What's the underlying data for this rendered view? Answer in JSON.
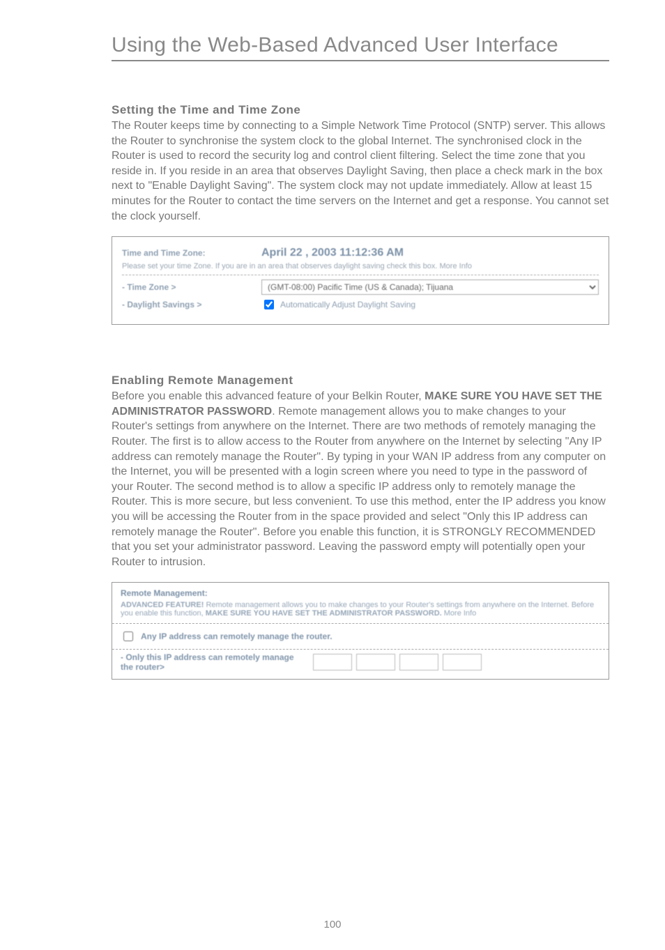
{
  "header": {
    "chapter_title": "Using the Web-Based Advanced User Interface"
  },
  "section1": {
    "title": "Setting the Time and Time Zone",
    "body": "The Router keeps time by connecting to a Simple Network Time Protocol (SNTP) server. This allows the Router to synchronise the system clock to the global Internet. The synchronised clock in the Router is used to record the security log and control client filtering. Select the time zone that you reside in. If you reside in an area that observes Daylight Saving, then place a check mark in the box next to \"Enable Daylight Saving\". The system clock may not update immediately. Allow at least 15 minutes for the Router to contact the time servers on the Internet and get a response. You cannot set the clock yourself."
  },
  "time_panel": {
    "heading": "Time and Time Zone:",
    "datetime": "April 22 , 2003     11:12:36 AM",
    "desc": "Please set your time Zone. If you are in an area that observes daylight saving check this box. More Info",
    "tz_label": "- Time Zone >",
    "tz_selected": "(GMT-08:00) Pacific Time (US & Canada); Tijuana",
    "ds_label": "- Daylight Savings >",
    "ds_checkbox_label": "Automatically Adjust Daylight Saving",
    "ds_checked": true
  },
  "section2": {
    "title": "Enabling Remote Management",
    "body_part1": "Before you enable this advanced feature of your Belkin Router, ",
    "body_bold1": "MAKE SURE YOU HAVE SET THE ADMINISTRATOR PASSWORD",
    "body_part2": ". Remote management allows you to make changes to your Router's settings from anywhere on the Internet. There are two methods of remotely managing the Router. The first is to allow access to the Router from anywhere on the Internet by selecting \"Any IP address can remotely manage the Router\". By typing in your WAN IP address from any computer on the Internet, you will be presented with a login screen where you need to type in the password of your Router. The second method is to allow a specific IP address only to remotely manage the Router. This is more secure, but less convenient. To use this method, enter the IP address you know you will be accessing the Router from in the space provided and select \"Only this IP address can remotely manage the Router\". Before you enable this function, it is STRONGLY RECOMMENDED that you set your administrator password. Leaving the password empty will potentially open your Router to intrusion."
  },
  "remote_panel": {
    "title": "Remote Management:",
    "desc_part1": "ADVANCED FEATURE! ",
    "desc_part2": "Remote management allows you to make changes to your Router's settings from anywhere on the Internet. Before you enable this function, ",
    "desc_bold": "MAKE SURE YOU HAVE SET THE ADMINISTRATOR PASSWORD.",
    "desc_part3": " More Info",
    "any_ip_label": "Any IP address can remotely manage the router.",
    "any_ip_checked": false,
    "only_ip_label": "- Only this IP address can remotely manage the router>",
    "ip": [
      "",
      "",
      "",
      ""
    ]
  },
  "footer": {
    "page_number": "100"
  }
}
